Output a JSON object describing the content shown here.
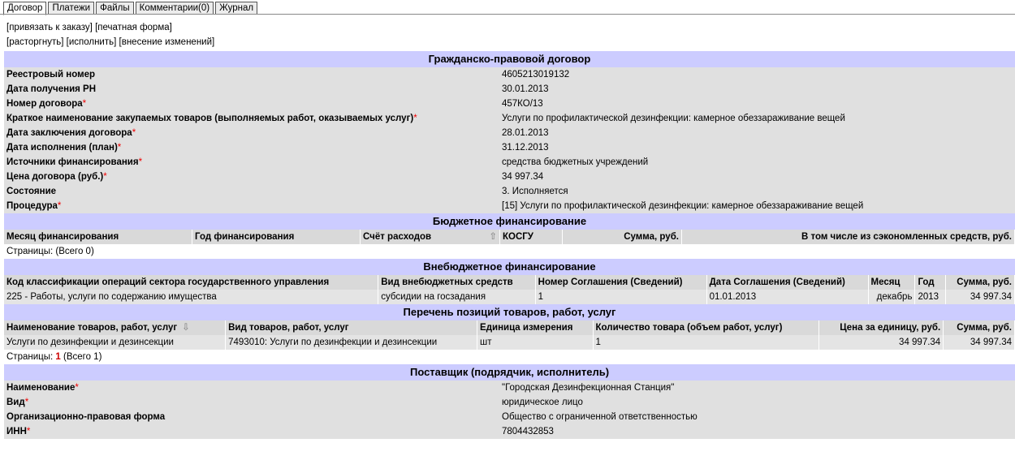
{
  "tabs": [
    "Договор",
    "Платежи",
    "Файлы",
    "Комментарии(0)",
    "Журнал"
  ],
  "links_row1": [
    "[привязать к заказу]",
    "[печатная форма]"
  ],
  "links_row2": [
    "[расторгнуть]",
    "[исполнить]",
    "[внесение изменений]"
  ],
  "contract": {
    "title": "Гражданско-правовой договор",
    "rows": [
      {
        "label": "Реестровый номер",
        "req": false,
        "value": "4605213019132"
      },
      {
        "label": "Дата получения РН",
        "req": false,
        "value": "30.01.2013"
      },
      {
        "label": "Номер договора",
        "req": true,
        "value": "457КО/13"
      },
      {
        "label": "Краткое наименование закупаемых товаров (выполняемых работ, оказываемых услуг)",
        "req": true,
        "value": "Услуги по профилактической дезинфекции: камерное обеззараживание вещей"
      },
      {
        "label": "Дата заключения договора",
        "req": true,
        "value": "28.01.2013"
      },
      {
        "label": "Дата исполнения (план)",
        "req": true,
        "value": "31.12.2013"
      },
      {
        "label": "Источники финансирования",
        "req": true,
        "value": "средства бюджетных учреждений"
      },
      {
        "label": "Цена договора (руб.)",
        "req": true,
        "value": "34 997.34"
      },
      {
        "label": "Состояние",
        "req": false,
        "value": "3. Исполняется"
      },
      {
        "label": "Процедура",
        "req": true,
        "value": "[15] Услуги по профилактической дезинфекции: камерное обеззараживание вещей"
      }
    ]
  },
  "budget": {
    "title": "Бюджетное финансирование",
    "headers": [
      "Месяц финансирования",
      "Год финансирования",
      "Счёт расходов",
      "КОСГУ",
      "Сумма, руб.",
      "В том числе из сэкономленных средств, руб."
    ],
    "pages": "Страницы:  (Всего 0)"
  },
  "extra": {
    "title": "Внебюджетное финансирование",
    "headers": [
      "Код классификации операций сектора государственного управления",
      "Вид внебюджетных средств",
      "Номер Соглашения (Сведений)",
      "Дата Соглашения (Сведений)",
      "Месяц",
      "Год",
      "Сумма, руб."
    ],
    "row": [
      "225 - Работы, услуги по содержанию имущества",
      "субсидии на госзадания",
      "1",
      "01.01.2013",
      "декабрь",
      "2013",
      "34 997.34"
    ]
  },
  "items": {
    "title": "Перечень позиций товаров, работ, услуг",
    "headers": [
      "Наименование товаров, работ, услуг",
      "Вид товаров, работ, услуг",
      "Единица измерения",
      "Количество товара (объем работ, услуг)",
      "Цена за единицу, руб.",
      "Сумма, руб."
    ],
    "row": [
      "Услуги по дезинфекции и дезинсекции",
      "7493010: Услуги по дезинфекции и дезинсекции",
      "шт",
      "1",
      "34 997.34",
      "34 997.34"
    ],
    "pages_label": "Страницы:",
    "pages_num": "1",
    "pages_total": "(Всего 1)"
  },
  "supplier": {
    "title": "Поставщик (подрядчик, исполнитель)",
    "rows": [
      {
        "label": "Наименование",
        "req": true,
        "value": "\"Городская Дезинфекционная Станция\""
      },
      {
        "label": "Вид",
        "req": true,
        "value": "юридическое лицо"
      },
      {
        "label": "Организационно-правовая форма",
        "req": false,
        "value": "Общество с ограниченной ответственностью"
      },
      {
        "label": "ИНН",
        "req": true,
        "value": "7804432853"
      }
    ]
  }
}
